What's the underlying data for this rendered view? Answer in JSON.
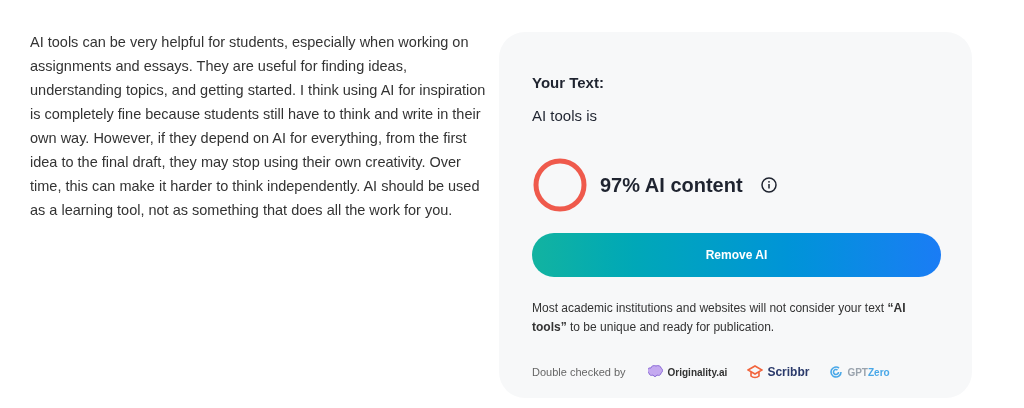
{
  "essay": "AI tools can be very helpful for students, especially when working on assignments and essays. They are useful for finding ideas, understanding topics, and getting started. I think using AI for inspiration is completely fine because students still have to think and write in their own way. However, if they depend on AI for everything, from the first idea to the final draft, they may stop using their own creativity. Over time, this can make it harder to think independently. AI should be used as a learning tool, not as something that does all the work for you.",
  "result": {
    "heading": "Your Text:",
    "excerpt": "AI tools is",
    "score": {
      "label": "97% AI content"
    },
    "button": "Remove AI",
    "note": "Most academic institutions and websites will not consider your text **“AI tools”** to be unique and ready for publication.",
    "checked_by": "Double checked by",
    "brands": [
      {
        "kind": "originality",
        "name": "Originality.ai"
      },
      {
        "kind": "scribbr",
        "name": "Scribbr"
      },
      {
        "kind": "gptzero",
        "name": "GPT",
        "accent": "Zero"
      }
    ]
  }
}
